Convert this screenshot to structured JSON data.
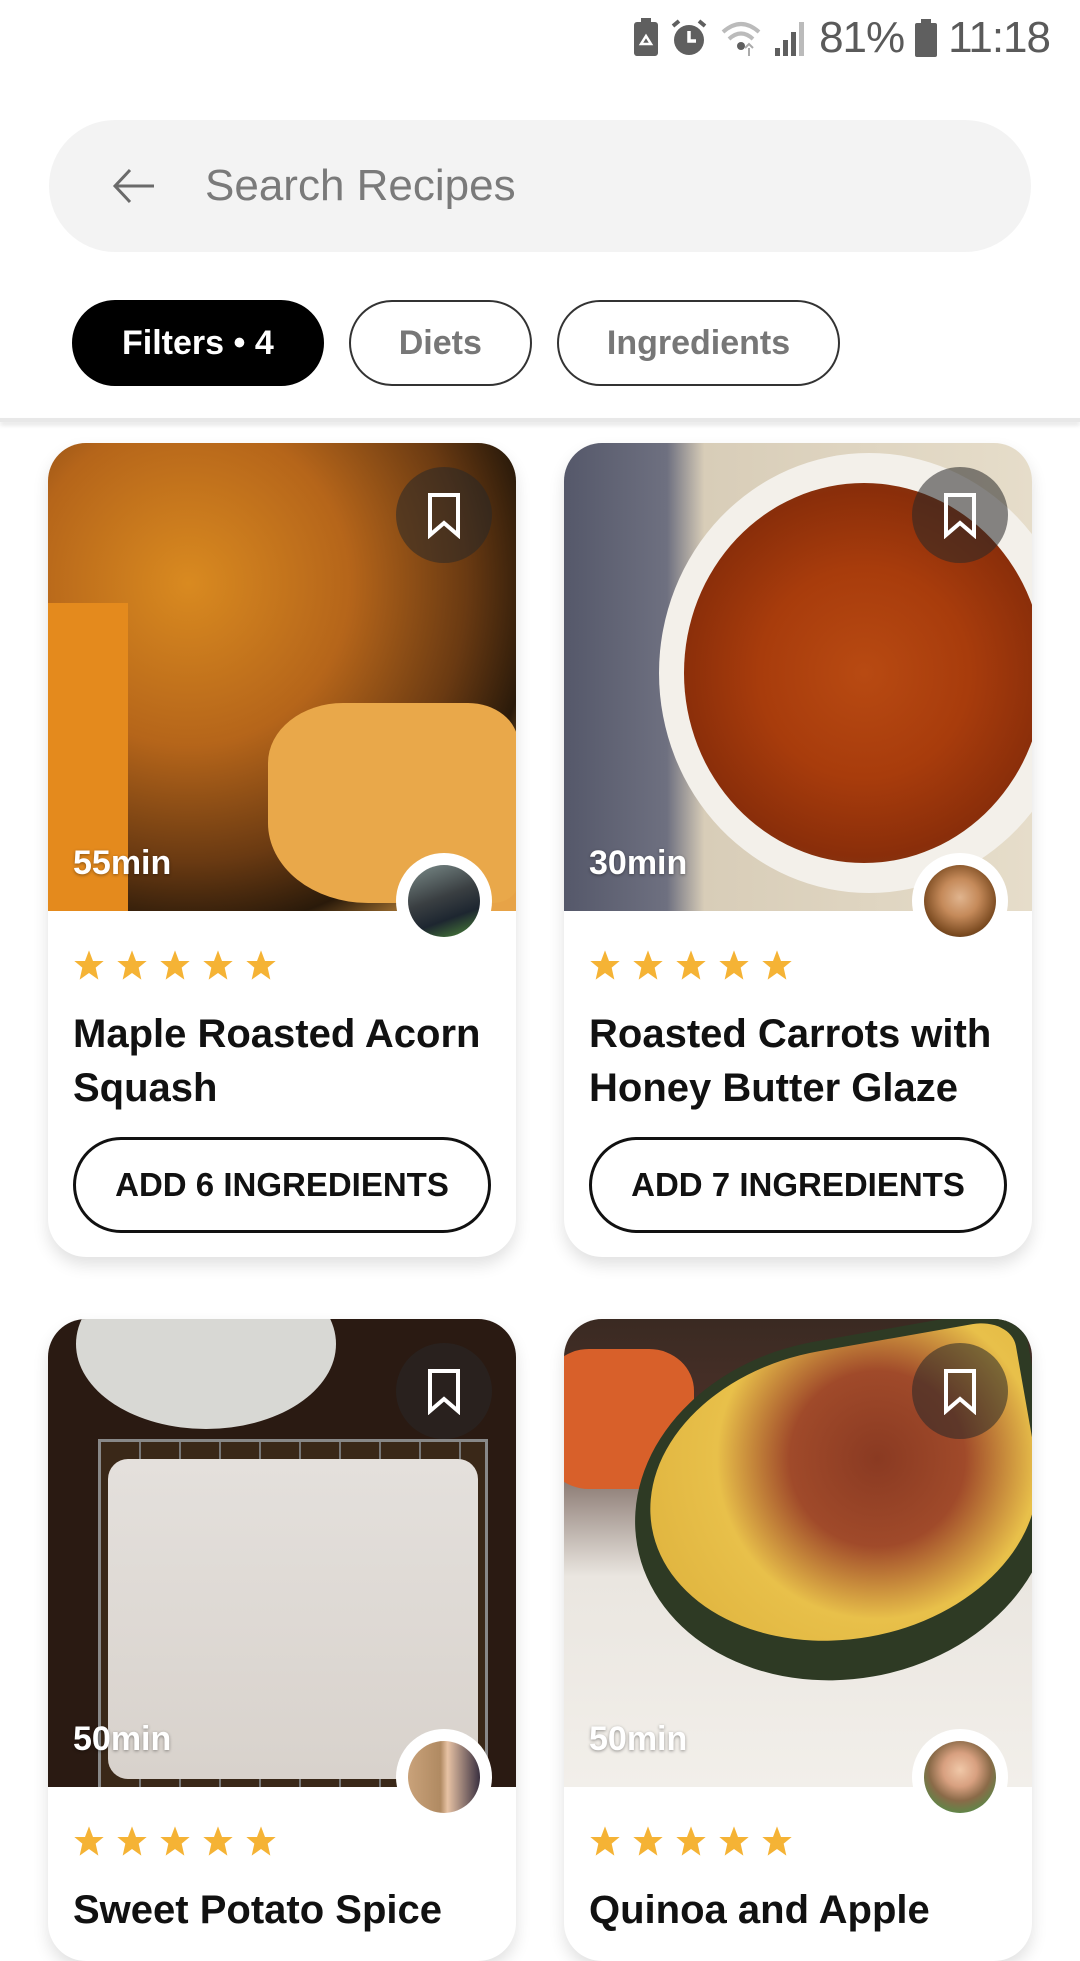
{
  "status_bar": {
    "battery_percent": "81%",
    "time": "11:18",
    "icons": [
      "battery-saver-icon",
      "alarm-icon",
      "wifi-icon",
      "signal-icon",
      "battery-icon"
    ]
  },
  "search": {
    "placeholder": "Search Recipes",
    "back_icon": "arrow-left-icon"
  },
  "chips": [
    {
      "label": "Filters • 4",
      "active": true
    },
    {
      "label": "Diets",
      "active": false
    },
    {
      "label": "Ingredients",
      "active": false
    }
  ],
  "colors": {
    "star": "#F5B335",
    "chip_active_bg": "#000000",
    "search_bg": "#F3F3F3"
  },
  "recipes": [
    {
      "time": "55min",
      "rating": 5,
      "title": "Maple Roasted Acorn Squash",
      "button": "ADD 6 INGREDIENTS"
    },
    {
      "time": "30min",
      "rating": 5,
      "title": "Roasted Carrots with Honey Butter Glaze",
      "button": "ADD 7 INGREDIENTS"
    },
    {
      "time": "50min",
      "rating": 5,
      "title": "Sweet Potato Spice",
      "button": ""
    },
    {
      "time": "50min",
      "rating": 5,
      "title": "Quinoa and Apple",
      "button": ""
    }
  ]
}
